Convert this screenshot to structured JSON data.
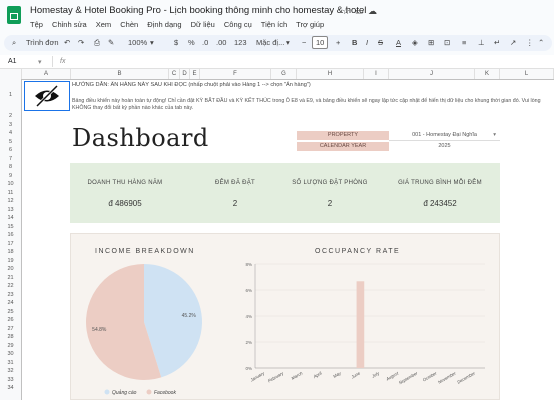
{
  "doc": {
    "title": "Homestay & Hotel Booking Pro -  Lịch booking thông minh cho homestay & hotel",
    "menu": [
      "Tệp",
      "Chỉnh sửa",
      "Xem",
      "Chèn",
      "Định dạng",
      "Dữ liệu",
      "Công cụ",
      "Tiện ích",
      "Trợ giúp"
    ]
  },
  "toolbar": {
    "search": "Trình đơn",
    "zoom": "100%",
    "currency": "$",
    "percent": "%",
    "dec_less": ".0",
    "dec_more": ".00",
    "num_format": "123",
    "font": "Mặc đị...",
    "font_size": "10"
  },
  "formula_bar": {
    "cell_ref": "A1",
    "fx": "fx"
  },
  "columns": [
    "A",
    "B",
    "C",
    "D",
    "E",
    "F",
    "G",
    "H",
    "I",
    "J",
    "K",
    "L"
  ],
  "rows": [
    "1",
    "2",
    "3",
    "4",
    "5",
    "6",
    "7",
    "8",
    "9",
    "10",
    "11",
    "12",
    "13",
    "14",
    "15",
    "16",
    "17",
    "18",
    "19",
    "20",
    "21",
    "22",
    "23",
    "24",
    "25",
    "26",
    "27",
    "28",
    "29",
    "30",
    "31",
    "32",
    "33",
    "34"
  ],
  "sheet": {
    "hint": "HƯỚNG DẪN: ẨN HÀNG NÀY SAU KHI ĐỌC (nhấp chuột phải vào Hàng 1 --> chọn \"Ẩn hàng\")",
    "hint2": "Bảng điều khiển này hoàn toàn tự động! Chỉ cần đặt KỲ BẮT ĐẦU và KỲ KẾT THÚC trong Ô E8 và E9, và bảng điều khiển sẽ ngay lập tức cập nhật để hiển thị dữ liệu cho khung thời gian đó. Vui lòng KHÔNG thay đổi bất kỳ phần nào khác của tab này."
  },
  "dashboard": {
    "title": "Dashboard",
    "property_label": "PROPERTY",
    "property_value": "001 - Homestay Đại Nghĩa",
    "year_label": "CALENDAR YEAR",
    "year_value": "2025",
    "kpis": [
      {
        "label": "DOANH THU HÀNG NĂM",
        "value": "đ 486905"
      },
      {
        "label": "ĐÊM ĐÃ ĐẶT",
        "value": "2"
      },
      {
        "label": "SỐ LƯỢNG ĐẶT PHÒNG",
        "value": "2"
      },
      {
        "label": "GIÁ TRUNG BÌNH MỖI ĐÊM",
        "value": "đ 243452"
      }
    ],
    "income_title": "INCOME BREAKDOWN",
    "occupancy_title": "OCCUPANCY RATE"
  },
  "chart_data": [
    {
      "type": "pie",
      "title": "INCOME BREAKDOWN",
      "labels": [
        "Quảng cáo",
        "Facebook"
      ],
      "values": [
        45.2,
        54.8
      ],
      "colors": [
        "#cfe2f3",
        "#eccdc4"
      ],
      "legend": "bottom"
    },
    {
      "type": "bar",
      "title": "OCCUPANCY RATE",
      "categories": [
        "January",
        "February",
        "March",
        "April",
        "May",
        "June",
        "July",
        "August",
        "September",
        "October",
        "November",
        "December"
      ],
      "values": [
        0,
        0,
        0,
        0,
        0,
        6.67,
        0,
        0,
        0,
        0,
        0,
        0
      ],
      "yticks": [
        "0%",
        "2%",
        "4%",
        "6%",
        "8%"
      ],
      "ylim": [
        0,
        8
      ],
      "color": "#eccdc4"
    }
  ]
}
